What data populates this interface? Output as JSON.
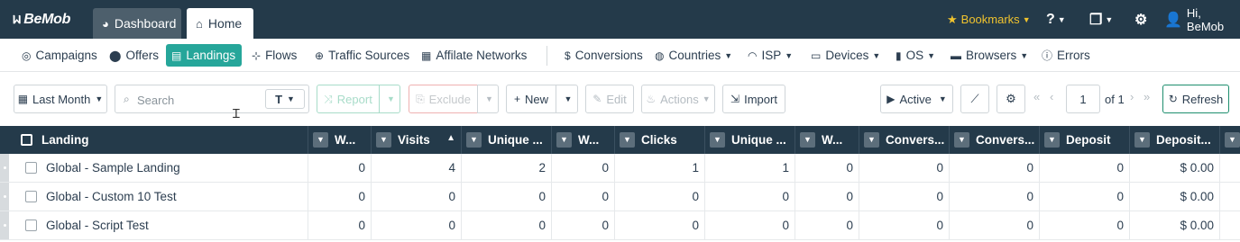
{
  "app": {
    "logo": "BeMob",
    "tabs": [
      {
        "label": "Dashboard"
      },
      {
        "label": "Home"
      }
    ],
    "bookmarks_label": "Bookmarks",
    "greeting": "Hi, BeMob"
  },
  "nav": {
    "items": [
      {
        "label": "Campaigns",
        "icon": "campaigns-icon"
      },
      {
        "label": "Offers",
        "icon": "offers-icon"
      },
      {
        "label": "Landings",
        "icon": "landings-icon",
        "active": true
      },
      {
        "label": "Flows",
        "icon": "flows-icon"
      },
      {
        "label": "Traffic Sources",
        "icon": "globe-icon"
      },
      {
        "label": "Affilate Networks",
        "icon": "network-icon"
      },
      {
        "label": "Conversions",
        "icon": "dollar-icon"
      },
      {
        "label": "Countries",
        "icon": "countries-icon"
      },
      {
        "label": "ISP",
        "icon": "wifi-icon"
      },
      {
        "label": "Devices",
        "icon": "laptop-icon"
      },
      {
        "label": "OS",
        "icon": "mobile-icon"
      },
      {
        "label": "Browsers",
        "icon": "browser-icon"
      },
      {
        "label": "Errors",
        "icon": "info-icon"
      }
    ]
  },
  "toolbar": {
    "date_range": "Last Month",
    "search_placeholder": "Search",
    "search_type": "T",
    "report_label": "Report",
    "exclude_label": "Exclude",
    "new_label": "New",
    "edit_label": "Edit",
    "actions_label": "Actions",
    "import_label": "Import",
    "status_filter": "Active",
    "page_number": "1",
    "page_of": "of 1",
    "refresh_label": "Refresh"
  },
  "table": {
    "columns": [
      "Landing",
      "W...",
      "Visits",
      "Unique ...",
      "W...",
      "Clicks",
      "Unique ...",
      "W...",
      "Convers...",
      "Convers...",
      "Deposit",
      "Deposit..."
    ],
    "sorted_column": "Visits",
    "rows": [
      {
        "name": "Global - Sample Landing",
        "cells": [
          "0",
          "4",
          "2",
          "0",
          "1",
          "1",
          "0",
          "0",
          "0",
          "0",
          "$ 0.00"
        ]
      },
      {
        "name": "Global - Custom 10 Test",
        "cells": [
          "0",
          "0",
          "0",
          "0",
          "0",
          "0",
          "0",
          "0",
          "0",
          "0",
          "$ 0.00"
        ]
      },
      {
        "name": "Global - Script Test",
        "cells": [
          "0",
          "0",
          "0",
          "0",
          "0",
          "0",
          "0",
          "0",
          "0",
          "0",
          "$ 0.00"
        ]
      }
    ]
  },
  "colors": {
    "topbar": "#243a4a",
    "accent": "#26a69a",
    "bookmarks": "#f0c32e"
  }
}
